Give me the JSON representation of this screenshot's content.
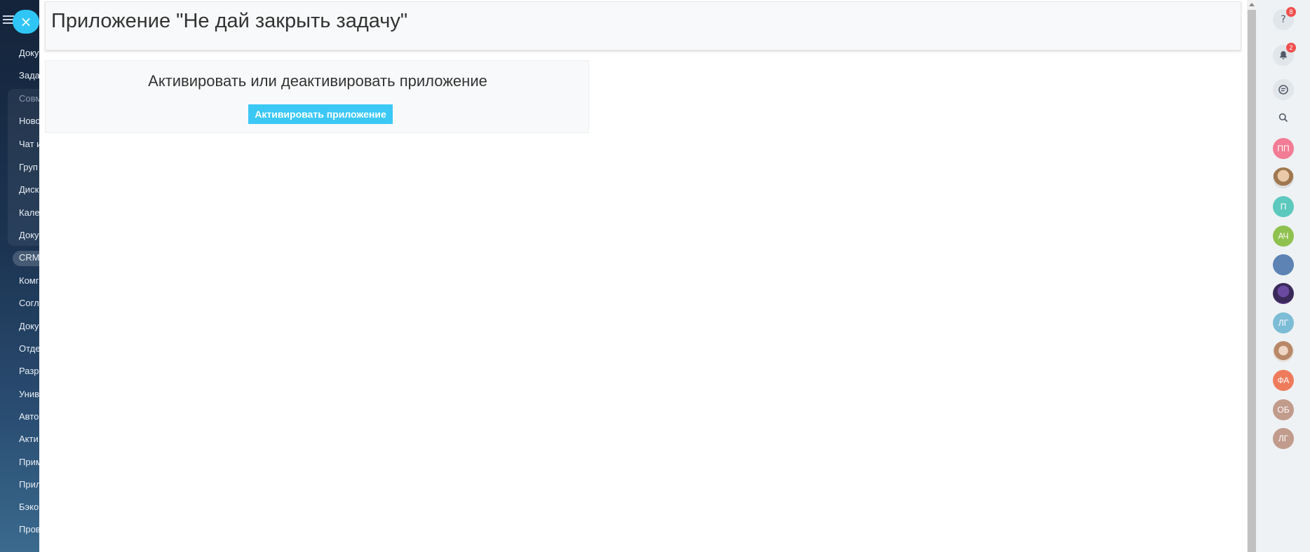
{
  "sidebar": {
    "close_label": "×",
    "items": [
      {
        "label": "Доку",
        "dim": false
      },
      {
        "label": "Зада",
        "dim": false
      },
      {
        "label": "Совм",
        "dim": true
      },
      {
        "label": "Ново",
        "dim": false
      },
      {
        "label": "Чат и",
        "dim": false
      },
      {
        "label": "Груп",
        "dim": false
      },
      {
        "label": "Диск",
        "dim": false
      },
      {
        "label": "Кале",
        "dim": false
      },
      {
        "label": "Доку",
        "dim": false
      },
      {
        "label": "CRM",
        "dim": false
      },
      {
        "label": "Комг",
        "dim": false
      },
      {
        "label": "Согл",
        "dim": false
      },
      {
        "label": "Доку",
        "dim": false
      },
      {
        "label": "Отде",
        "dim": false
      },
      {
        "label": "Разр",
        "dim": false
      },
      {
        "label": "Унив",
        "dim": false
      },
      {
        "label": "Авто",
        "dim": false
      },
      {
        "label": "Акти",
        "dim": false
      },
      {
        "label": "Прим",
        "dim": false
      },
      {
        "label": "Прил",
        "dim": false
      },
      {
        "label": "Бэко",
        "dim": false
      },
      {
        "label": "Пров",
        "dim": false
      }
    ]
  },
  "header": {
    "title": "Приложение \"Не дай закрыть задачу\""
  },
  "card": {
    "title": "Активировать или деактивировать приложение",
    "button_label": "Активировать приложение"
  },
  "right_panel": {
    "help": {
      "icon": "question-icon",
      "badge": "8"
    },
    "notifications": {
      "icon": "bell-icon",
      "badge": "2"
    },
    "chat": {
      "icon": "chat-icon"
    },
    "search": {
      "icon": "search-icon"
    },
    "avatars": [
      {
        "initials": "ПП",
        "color": "#f27c95"
      },
      {
        "initials": "",
        "color": "photo1"
      },
      {
        "initials": "П",
        "color": "#5dc9be"
      },
      {
        "initials": "АЧ",
        "color": "#8fc14f"
      },
      {
        "initials": "",
        "color": "#5c83b4"
      },
      {
        "initials": "",
        "color": "photo2"
      },
      {
        "initials": "ЛГ",
        "color": "#7cbcd6"
      },
      {
        "initials": "",
        "color": "photo3"
      },
      {
        "initials": "ФА",
        "color": "#ee7c5c"
      },
      {
        "initials": "ОБ",
        "color": "#c19b8c"
      },
      {
        "initials": "ЛГ",
        "color": "#c19b8c"
      }
    ]
  }
}
